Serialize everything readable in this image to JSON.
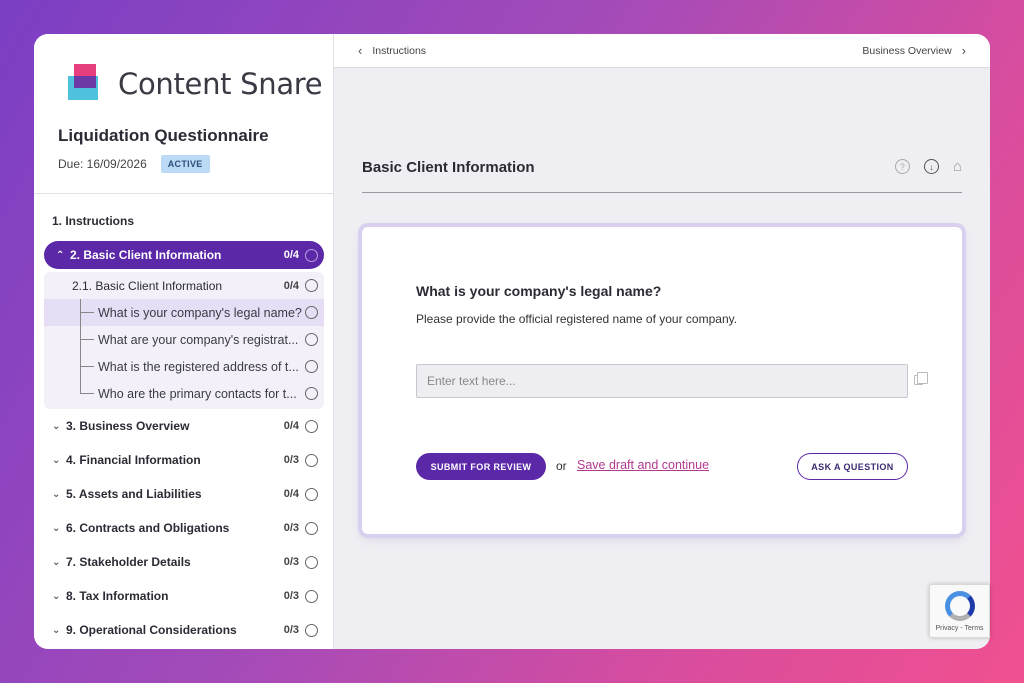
{
  "brand": {
    "name": "Content Snare"
  },
  "questionnaire": {
    "title": "Liquidation Questionnaire",
    "due": "Due: 16/09/2026",
    "status": "ACTIVE"
  },
  "sidebar": {
    "sections": [
      {
        "label": "1. Instructions",
        "count": ""
      },
      {
        "label": "2. Basic Client Information",
        "count": "0/4"
      },
      {
        "label": "3. Business Overview",
        "count": "0/4"
      },
      {
        "label": "4. Financial Information",
        "count": "0/3"
      },
      {
        "label": "5. Assets and Liabilities",
        "count": "0/4"
      },
      {
        "label": "6. Contracts and Obligations",
        "count": "0/3"
      },
      {
        "label": "7. Stakeholder Details",
        "count": "0/3"
      },
      {
        "label": "8. Tax Information",
        "count": "0/3"
      },
      {
        "label": "9. Operational Considerations",
        "count": "0/3"
      }
    ],
    "subsection": {
      "label": "2.1. Basic Client Information",
      "count": "0/4"
    },
    "questions": [
      "What is your company's legal name?",
      "What are your company's registrat...",
      "What is the registered address of t...",
      "Who are the primary contacts for t..."
    ]
  },
  "topbar": {
    "prev_label": "Instructions",
    "next_label": "Business Overview"
  },
  "section": {
    "title": "Basic Client Information"
  },
  "question": {
    "heading": "What is your company's legal name?",
    "description": "Please provide the official registered name of your company.",
    "placeholder": "Enter text here...",
    "value": ""
  },
  "actions": {
    "submit_label": "SUBMIT FOR REVIEW",
    "or_label": "or",
    "draft_label": "Save draft and continue",
    "ask_label": "ASK A QUESTION"
  },
  "recaptcha": {
    "text": "Privacy - Terms"
  },
  "colors": {
    "accent": "#5b28a8",
    "link": "#b23a8f",
    "badge_bg": "#bcd9f5",
    "background_gradient_start": "#7b3fc4",
    "background_gradient_end": "#f0508f"
  },
  "icons": [
    "chevron-left-icon",
    "chevron-right-icon",
    "help-icon",
    "download-icon",
    "home-icon",
    "copy-icon",
    "recaptcha-icon"
  ]
}
